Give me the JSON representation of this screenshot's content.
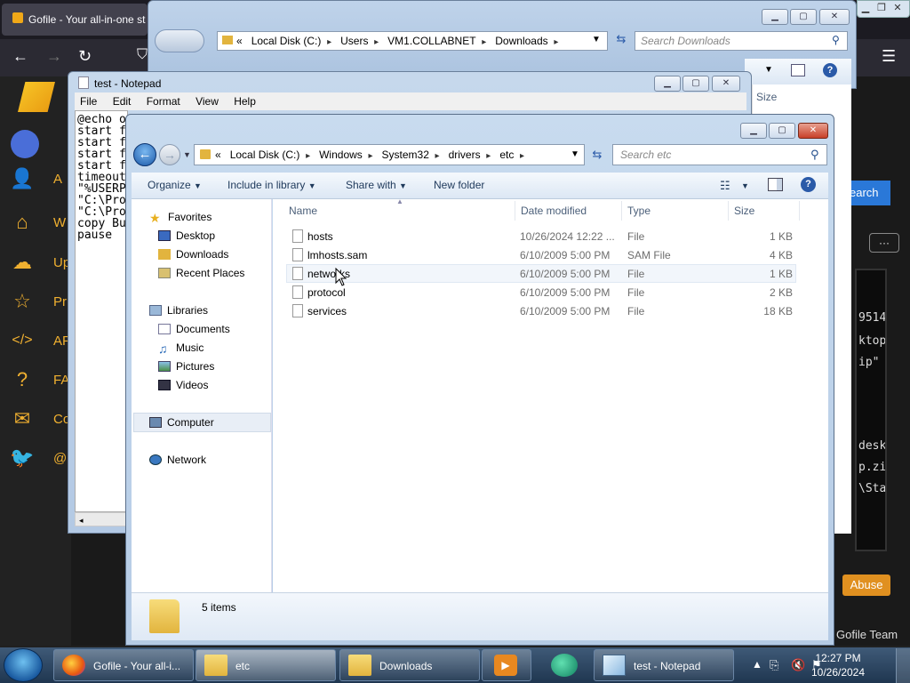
{
  "firefox": {
    "tab_title": "Gofile - Your all-in-one st",
    "colors": {
      "accent": "#f0b030",
      "search_btn": "#2a78d8"
    }
  },
  "gofile": {
    "avatar_text": "",
    "sidebar": [
      {
        "icon": "add-user-icon",
        "label": "A"
      },
      {
        "icon": "home-icon",
        "label": "W"
      },
      {
        "icon": "upload-icon",
        "label": "Up"
      },
      {
        "icon": "star-icon",
        "label": "Pr"
      },
      {
        "icon": "code-icon",
        "label": "AF"
      },
      {
        "icon": "question-icon",
        "label": "FA"
      },
      {
        "icon": "envelope-icon",
        "label": "Co"
      },
      {
        "icon": "twitter-icon",
        "label": "@"
      }
    ],
    "search_label": "earch",
    "more_label": "···",
    "terminal_lines": [
      "9514",
      "ktop",
      "ip\"",
      "",
      "desk",
      "p.zi",
      "\\Sta"
    ],
    "abuse_label": "Abuse",
    "team_label": "Gofile Team"
  },
  "downloads_window": {
    "breadcrumbs": [
      "«",
      "Local Disk (C:)",
      "Users",
      "VM1.COLLABNET",
      "Downloads"
    ],
    "search_placeholder": "Search Downloads",
    "size_header": "Size"
  },
  "notepad": {
    "title": "test - Notepad",
    "menu": [
      "File",
      "Edit",
      "Format",
      "View",
      "Help"
    ],
    "lines": [
      "@echo o",
      "start f",
      "start f",
      "start f",
      "start f",
      "timeout",
      "\"%USERP",
      "\"C:\\Pro",
      "\"C:\\Pro",
      "copy Bu",
      "pause"
    ]
  },
  "explorer": {
    "breadcrumbs": [
      "«",
      "Local Disk (C:)",
      "Windows",
      "System32",
      "drivers",
      "etc"
    ],
    "search_placeholder": "Search etc",
    "toolbar": {
      "organize": "Organize",
      "include": "Include in library",
      "share": "Share with",
      "new_folder": "New folder"
    },
    "nav": {
      "favorites": "Favorites",
      "fav_items": [
        "Desktop",
        "Downloads",
        "Recent Places"
      ],
      "libraries": "Libraries",
      "lib_items": [
        "Documents",
        "Music",
        "Pictures",
        "Videos"
      ],
      "computer": "Computer",
      "network": "Network"
    },
    "columns": {
      "name": "Name",
      "date": "Date modified",
      "type": "Type",
      "size": "Size"
    },
    "files": [
      {
        "name": "hosts",
        "date": "10/26/2024 12:22 ...",
        "type": "File",
        "size": "1 KB"
      },
      {
        "name": "lmhosts.sam",
        "date": "6/10/2009 5:00 PM",
        "type": "SAM File",
        "size": "4 KB"
      },
      {
        "name": "networks",
        "date": "6/10/2009 5:00 PM",
        "type": "File",
        "size": "1 KB"
      },
      {
        "name": "protocol",
        "date": "6/10/2009 5:00 PM",
        "type": "File",
        "size": "2 KB"
      },
      {
        "name": "services",
        "date": "6/10/2009 5:00 PM",
        "type": "File",
        "size": "18 KB"
      }
    ],
    "status": "5 items"
  },
  "taskbar": {
    "items": [
      {
        "label": "Gofile - Your all-i...",
        "icon": "firefox-icon"
      },
      {
        "label": "etc",
        "icon": "folder-icon"
      },
      {
        "label": "Downloads",
        "icon": "folder-icon"
      },
      {
        "label": "",
        "icon": "media-player-icon"
      },
      {
        "label": "",
        "icon": "chat-icon"
      },
      {
        "label": "test - Notepad",
        "icon": "notepad-icon"
      }
    ],
    "time": "12:27 PM",
    "date": "10/26/2024"
  }
}
